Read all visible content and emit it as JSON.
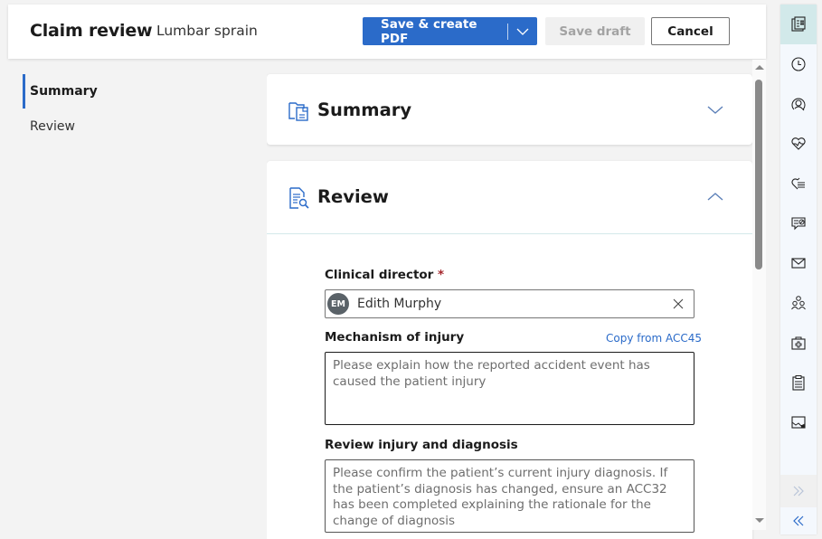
{
  "header": {
    "title": "Claim review",
    "subtitle": "Lumbar sprain",
    "primary_button": "Save & create PDF",
    "draft_button": "Save draft",
    "cancel_button": "Cancel"
  },
  "nav": {
    "items": [
      {
        "label": "Summary",
        "active": true
      },
      {
        "label": "Review",
        "active": false
      }
    ]
  },
  "sections": {
    "summary": {
      "title": "Summary",
      "icon": "folder-document-icon",
      "expanded": false
    },
    "review": {
      "title": "Review",
      "icon": "document-search-icon",
      "expanded": true
    }
  },
  "form": {
    "clinical_director": {
      "label": "Clinical director",
      "required_mark": "*",
      "avatar_initials": "EM",
      "value": "Edith Murphy"
    },
    "mechanism_of_injury": {
      "label": "Mechanism of injury",
      "copy_link": "Copy from ACC45",
      "placeholder": "Please explain how the reported accident event has caused the patient injury"
    },
    "review_injury": {
      "label": "Review injury and diagnosis",
      "placeholder": "Please confirm the patient’s current injury diagnosis. If the patient’s diagnosis has changed, ensure an ACC32 has been completed explaining the rationale for the change of diagnosis"
    }
  },
  "rail": {
    "icons": [
      "claim-form-icon",
      "history-icon",
      "patient-search-icon",
      "health-icon",
      "treatment-list-icon",
      "notes-icon",
      "mail-icon",
      "team-icon",
      "medical-kit-icon",
      "clipboard-icon",
      "image-icon"
    ],
    "active_index": 0
  },
  "colors": {
    "accent": "#2b6bc9",
    "rail_active": "#d2e9ea",
    "required": "#a4262c"
  }
}
